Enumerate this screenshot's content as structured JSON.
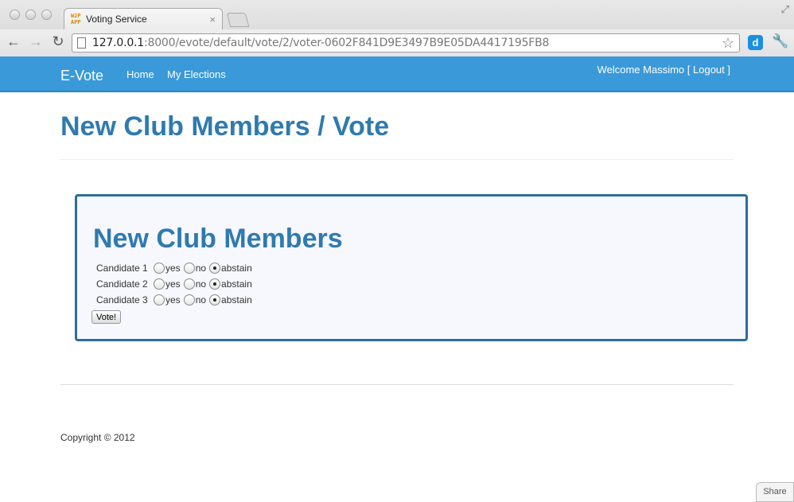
{
  "browser": {
    "tab_title": "Voting Service",
    "tab_favicon_text": "W2P APP",
    "url_host": "127.0.0.1",
    "url_rest": ":8000/evote/default/vote/2/voter-0602F841D9E3497B9E05DA4417195FB8",
    "extension_label": "d"
  },
  "navbar": {
    "brand": "E-Vote",
    "links": [
      "Home",
      "My Elections"
    ],
    "welcome_text": "Welcome Massimo ",
    "logout_label": "[ Logout ]"
  },
  "page": {
    "title": "New Club Members / Vote"
  },
  "ballot": {
    "title": "New Club Members",
    "options": [
      "yes",
      "no",
      "abstain"
    ],
    "candidates": [
      {
        "name": "Candidate 1",
        "selected": "abstain"
      },
      {
        "name": "Candidate 2",
        "selected": "abstain"
      },
      {
        "name": "Candidate 3",
        "selected": "abstain"
      }
    ],
    "submit_label": "Vote!"
  },
  "footer": {
    "copyright": "Copyright © 2012"
  },
  "share_label": "Share",
  "colors": {
    "navbar": "#3a99d8",
    "title": "#2f7ab0",
    "ballot_border": "#2a6e9a"
  }
}
